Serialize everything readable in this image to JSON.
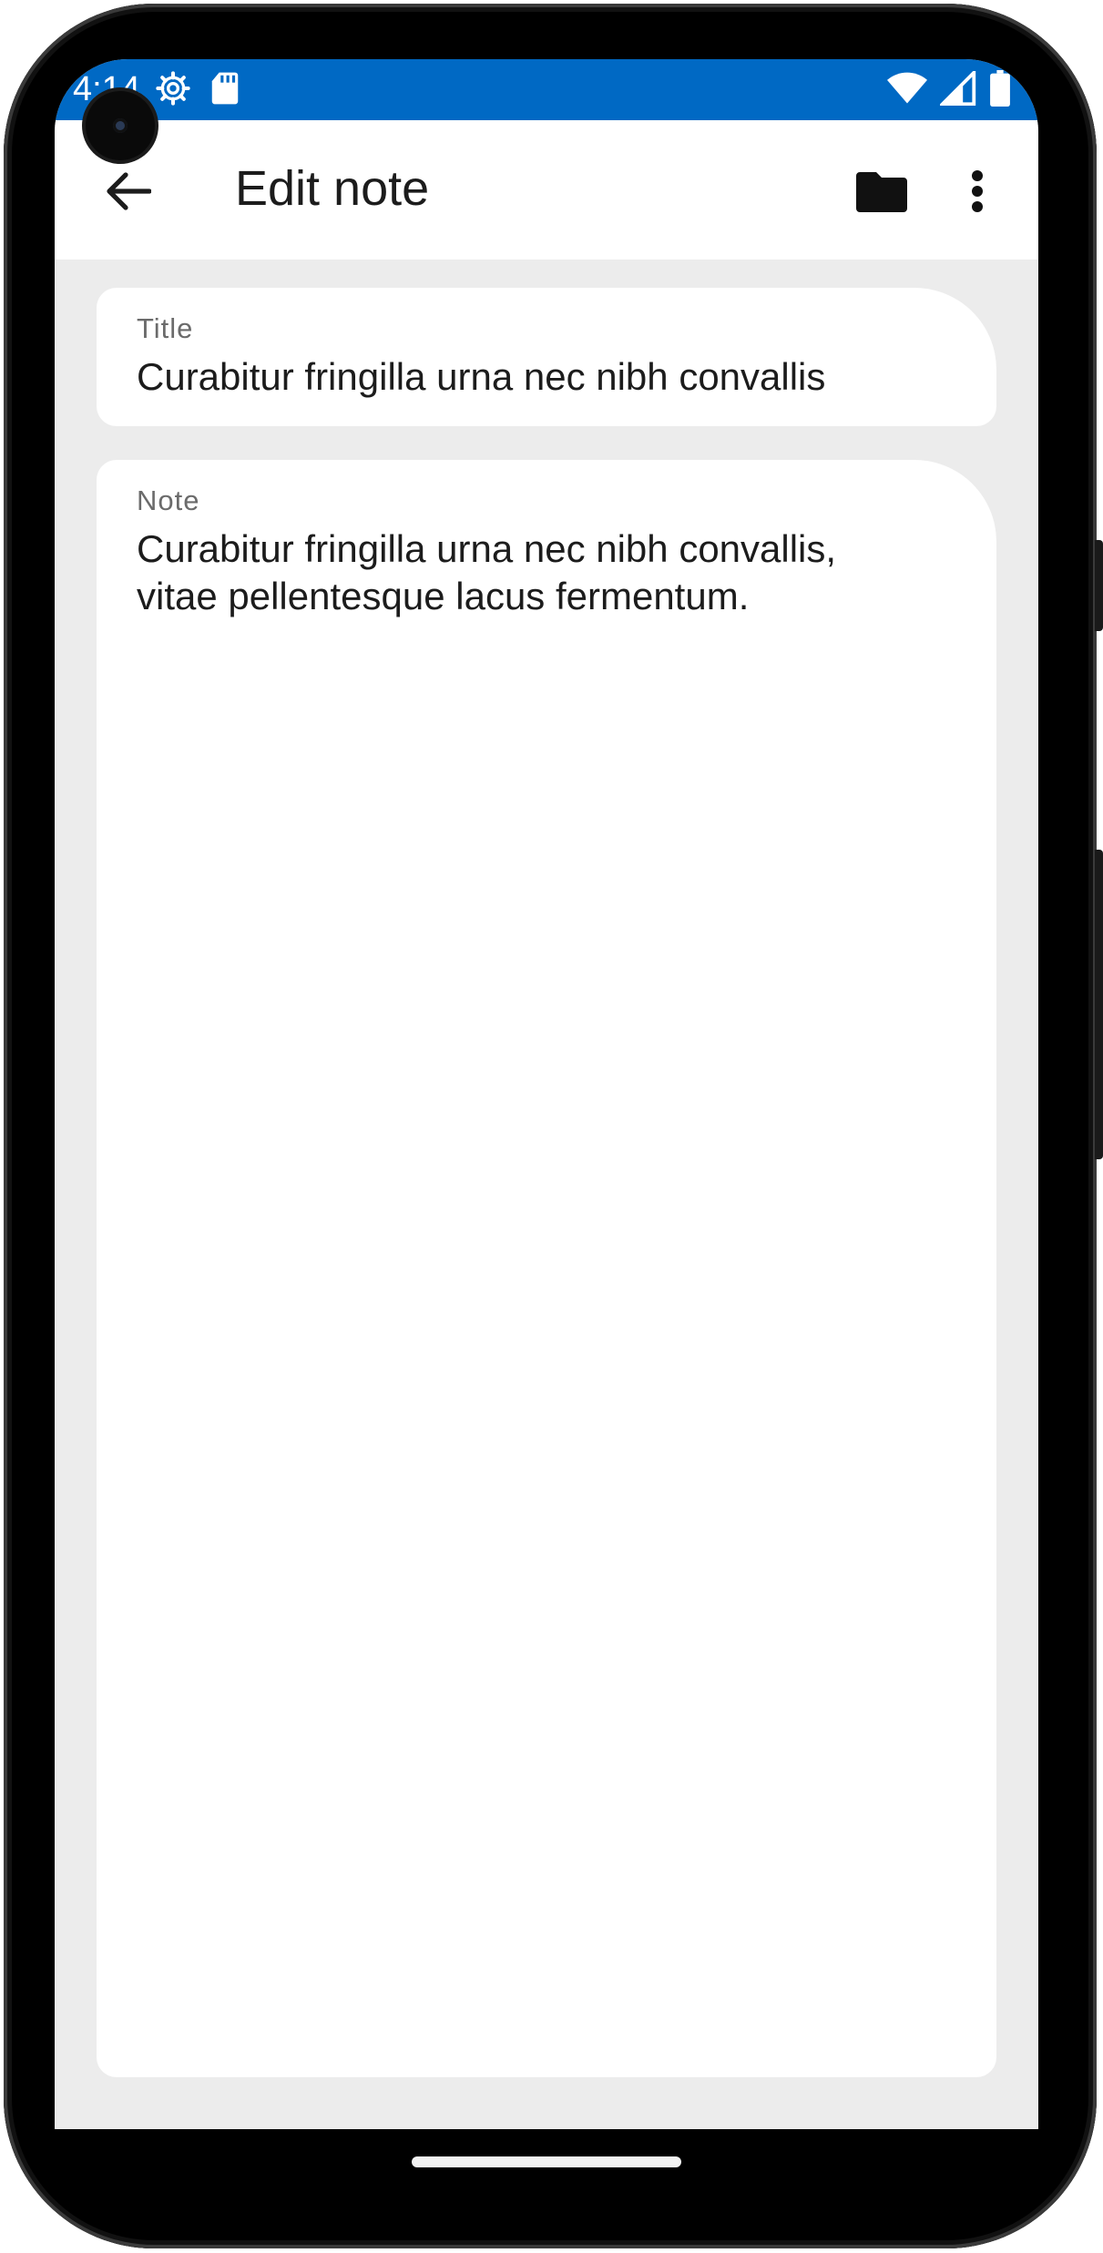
{
  "status_bar": {
    "time": "4:14",
    "background_color": "#0069c4",
    "left_icons": [
      "settings-icon",
      "sd-card-icon"
    ],
    "right_icons": [
      "wifi-icon",
      "signal-icon",
      "battery-icon"
    ]
  },
  "app_bar": {
    "title": "Edit note",
    "back_icon": "arrow-back-icon",
    "actions": [
      "folder-icon",
      "more-vert-icon"
    ]
  },
  "title_field": {
    "label": "Title",
    "value": "Curabitur fringilla urna nec nibh convallis"
  },
  "note_field": {
    "label": "Note",
    "value": "Curabitur fringilla urna nec nibh convallis,\nvitae pellentesque lacus fermentum."
  }
}
